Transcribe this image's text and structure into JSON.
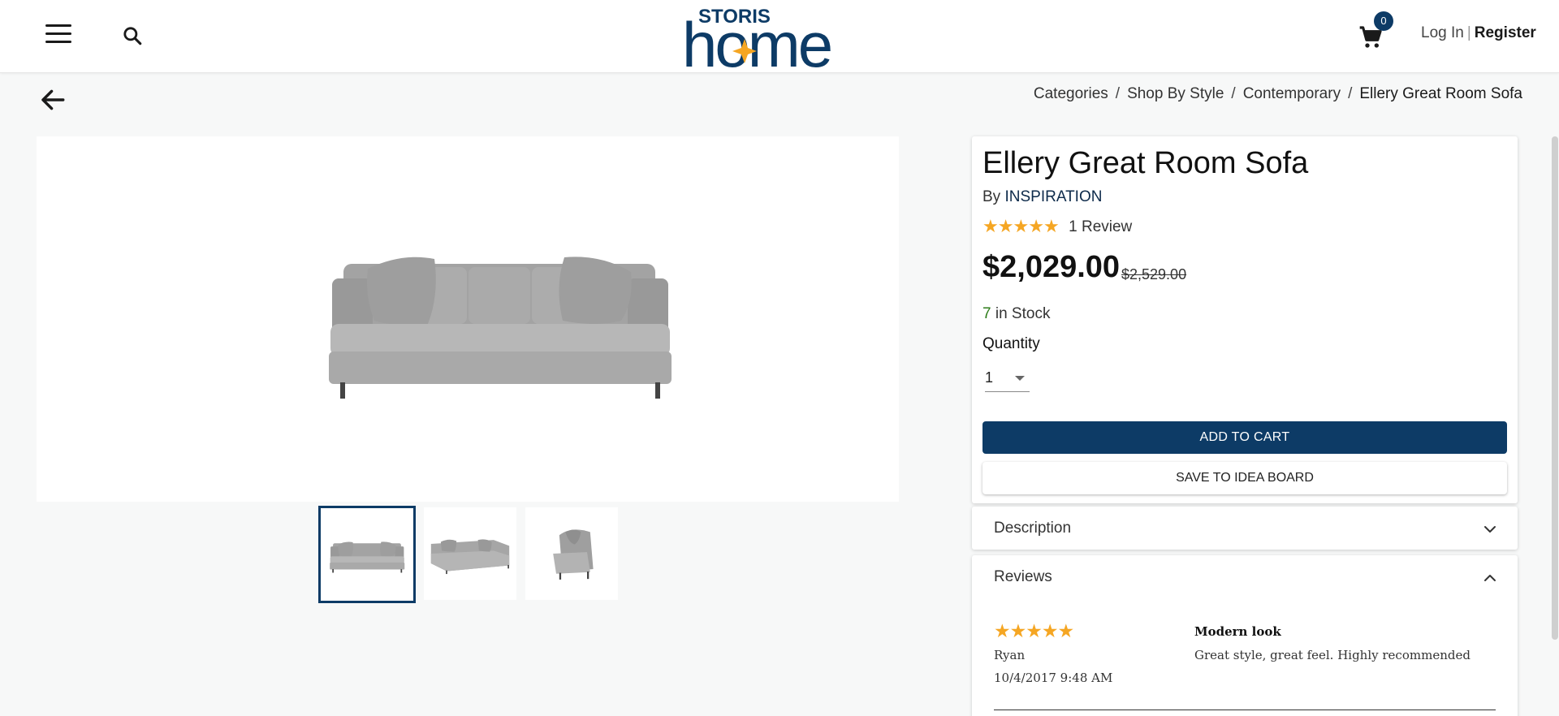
{
  "header": {
    "logo_top_text": "STORIS",
    "logo_main_text": "home",
    "cart_count": "0",
    "login_label": "Log In",
    "separator": "|",
    "register_label": "Register"
  },
  "breadcrumb": {
    "items": [
      "Categories",
      "Shop By Style",
      "Contemporary"
    ],
    "divider": "/",
    "current": "Ellery Great Room Sofa"
  },
  "product": {
    "title": "Ellery Great Room Sofa",
    "by_label": "By",
    "brand": "INSPIRATION",
    "rating": 5,
    "review_count_label": "1 Review",
    "price": "$2,029.00",
    "original_price": "$2,529.00",
    "stock_count": "7",
    "stock_label": "in Stock",
    "quantity_label": "Quantity",
    "quantity_value": "1",
    "add_to_cart_label": "ADD TO CART",
    "save_label": "SAVE TO IDEA BOARD"
  },
  "description": {
    "label": "Description"
  },
  "reviews": {
    "label": "Reviews",
    "items": [
      {
        "rating": 5,
        "author": "Ryan",
        "date": "10/4/2017 9:48 AM",
        "title": "Modern look",
        "body": "Great style, great feel. Highly recommended"
      }
    ]
  },
  "colors": {
    "brand_navy": "#0d3b66",
    "star_gold": "#f5a623",
    "stock_green": "#2e7d1a"
  },
  "icons": [
    "menu-icon",
    "search-icon",
    "cart-icon",
    "back-arrow-icon",
    "star-icon",
    "chevron-down-icon",
    "chevron-up-icon"
  ]
}
